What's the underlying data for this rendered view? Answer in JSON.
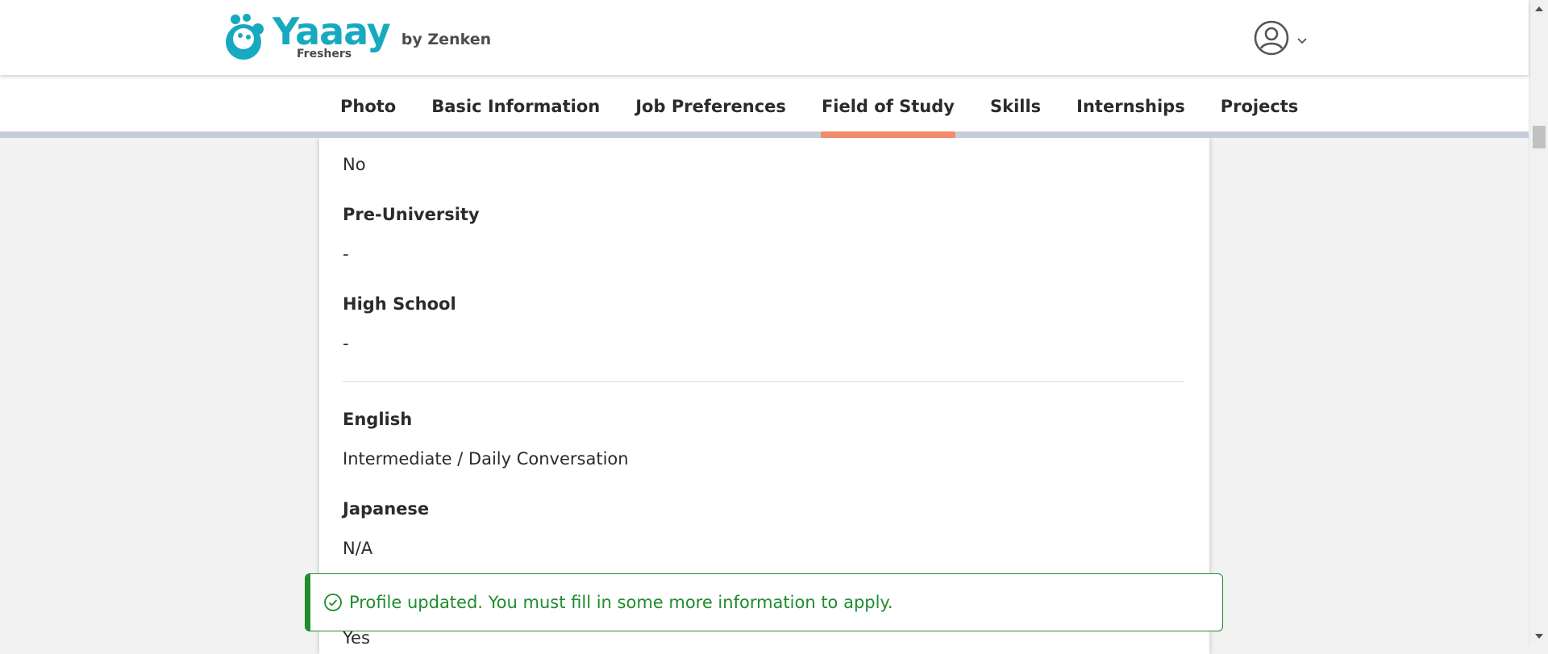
{
  "brand": {
    "name": "Yaaay",
    "subtitle": "Freshers",
    "by": "by Zenken",
    "color": "#17a9bf"
  },
  "header": {
    "account_icon": "user-circle-icon",
    "dropdown_icon": "chevron-down-icon"
  },
  "nav": {
    "tabs": [
      {
        "label": "Photo"
      },
      {
        "label": "Basic Information"
      },
      {
        "label": "Job Preferences"
      },
      {
        "label": "Field of Study",
        "active": true
      },
      {
        "label": "Skills"
      },
      {
        "label": "Internships"
      },
      {
        "label": "Projects"
      }
    ],
    "active_color": "#f28b6b"
  },
  "profile": {
    "top_value": "No",
    "pre_university": {
      "label": "Pre-University",
      "value": "-"
    },
    "high_school": {
      "label": "High School",
      "value": "-"
    },
    "english": {
      "label": "English",
      "value": "Intermediate / Daily Conversation"
    },
    "japanese": {
      "label": "Japanese",
      "value": "N/A"
    },
    "bottom_value": "Yes"
  },
  "toast": {
    "message": "Profile updated. You must fill in some more information to apply.",
    "icon": "check-circle-icon",
    "color": "#1f8c2e"
  }
}
